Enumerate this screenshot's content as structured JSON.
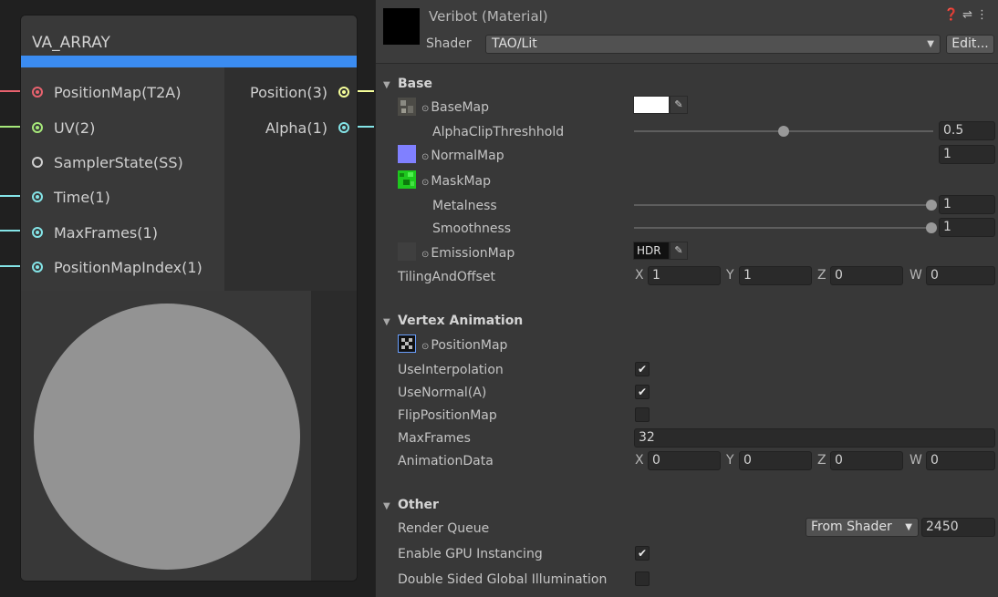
{
  "graph": {
    "node_title": "VA_ARRAY",
    "inputs": [
      {
        "label": "PositionMap(T2A)",
        "color": "#e8626e",
        "icon": "port-texture"
      },
      {
        "label": "UV(2)",
        "color": "#a6e87a",
        "icon": "port-vector2"
      },
      {
        "label": "SamplerState(SS)",
        "color": "#d0d0d0",
        "icon": "port-sampler-empty"
      },
      {
        "label": "Time(1)",
        "color": "#84e4e7",
        "icon": "port-float"
      },
      {
        "label": "MaxFrames(1)",
        "color": "#84e4e7",
        "icon": "port-float"
      },
      {
        "label": "PositionMapIndex(1)",
        "color": "#84e4e7",
        "icon": "port-float"
      }
    ],
    "outputs": [
      {
        "label": "Position(3)",
        "color": "#f6ff9a",
        "icon": "port-vector3"
      },
      {
        "label": "Alpha(1)",
        "color": "#84e4e7",
        "icon": "port-float"
      }
    ],
    "accent": "#3b8cf1",
    "preview_color": "#939393"
  },
  "inspector": {
    "material_title": "Veribot (Material)",
    "header_icons": [
      "help-icon",
      "presets-icon",
      "more-icon"
    ],
    "shader_label": "Shader",
    "shader_value": "TAO/Lit",
    "edit_label": "Edit...",
    "base": {
      "title": "Base",
      "base_map": "BaseMap",
      "alpha_clip_label": "AlphaClipThreshhold",
      "alpha_clip_value": "0.5",
      "alpha_clip_fraction": 0.5,
      "normal_map": "NormalMap",
      "normal_value": "1",
      "mask_map": "MaskMap",
      "metalness_label": "Metalness",
      "metalness_value": "1",
      "metalness_fraction": 1.0,
      "smoothness_label": "Smoothness",
      "smoothness_value": "1",
      "smoothness_fraction": 1.0,
      "emission_map": "EmissionMap",
      "hdr_label": "HDR",
      "tiling_label": "TilingAndOffset",
      "tiling": [
        {
          "axis": "X",
          "value": "1"
        },
        {
          "axis": "Y",
          "value": "1"
        },
        {
          "axis": "Z",
          "value": "0"
        },
        {
          "axis": "W",
          "value": "0"
        }
      ]
    },
    "vertex": {
      "title": "Vertex Animation",
      "position_map": "PositionMap",
      "use_interp_label": "UseInterpolation",
      "use_interp": true,
      "use_normal_label": "UseNormal(A)",
      "use_normal": true,
      "flip_label": "FlipPositionMap",
      "flip": false,
      "max_frames_label": "MaxFrames",
      "max_frames_value": "32",
      "anim_label": "AnimationData",
      "anim": [
        {
          "axis": "X",
          "value": "0"
        },
        {
          "axis": "Y",
          "value": "0"
        },
        {
          "axis": "Z",
          "value": "0"
        },
        {
          "axis": "W",
          "value": "0"
        }
      ]
    },
    "other": {
      "title": "Other",
      "render_queue_label": "Render Queue",
      "render_queue_mode": "From Shader",
      "render_queue_value": "2450",
      "gpu_label": "Enable GPU Instancing",
      "gpu": true,
      "dsgi_label": "Double Sided Global Illumination",
      "dsgi": false
    }
  }
}
